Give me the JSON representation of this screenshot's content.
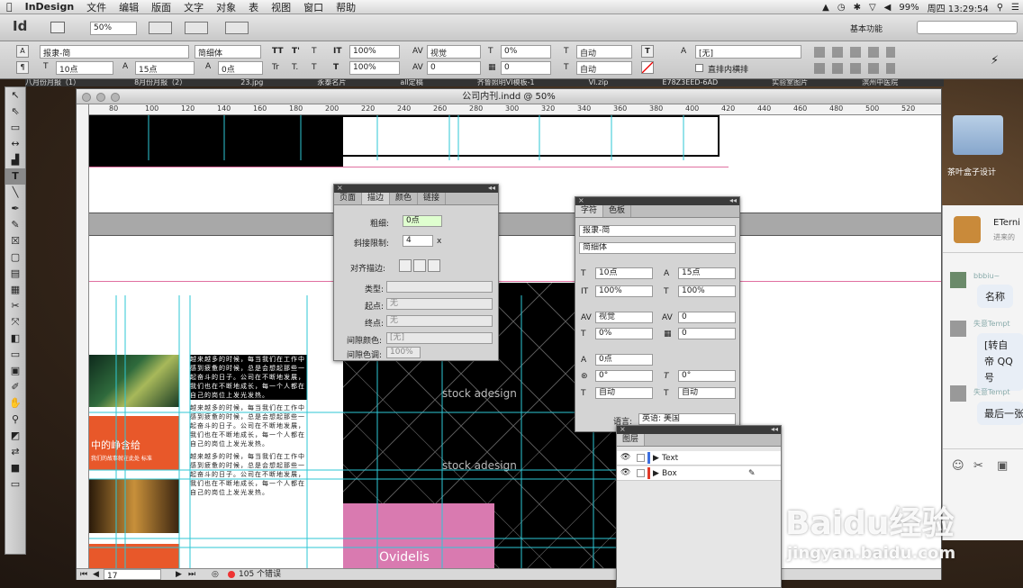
{
  "menubar": {
    "app": "InDesign",
    "items": [
      "文件",
      "编辑",
      "版面",
      "文字",
      "对象",
      "表",
      "视图",
      "窗口",
      "帮助"
    ],
    "battery": "99%",
    "clock": "周四 13:29:54"
  },
  "appbar": {
    "logo": "Id",
    "zoom": "50%",
    "workspace": "基本功能"
  },
  "control": {
    "font_family": "报隶-简",
    "font_style": "简细体",
    "font_size": "10点",
    "leading": "15点",
    "scale_v": "100%",
    "scale_h": "100%",
    "tracking": "视觉",
    "kerning": "0",
    "baseline": "0点",
    "skew": "0%",
    "tt": "TT",
    "tt2": "T'",
    "t3": "T",
    "tr": "Tr",
    "tr2": "T.",
    "tr3": "T",
    "auto1": "自动",
    "auto2": "自动",
    "none": "[无]",
    "shading_label": "直排内横排",
    "a_label": "A"
  },
  "tabs": [
    "八月份月报（1）",
    "8月份月报（2）",
    "23.jpg",
    "永泰名片",
    "all定稿",
    "齐鲁照明VI模板-1",
    "VI.zip",
    "E78Z3EED-6AD",
    "实验室图片",
    "滨州中医院"
  ],
  "document": {
    "title": "公司内刊.indd @ 50%",
    "ruler": [
      "80",
      "100",
      "120",
      "140",
      "160",
      "180",
      "200",
      "220",
      "240",
      "260",
      "280",
      "300",
      "320",
      "340",
      "360",
      "380",
      "400",
      "420",
      "440",
      "460",
      "480",
      "500",
      "520"
    ],
    "page_num": "17",
    "errors": "105 个错误",
    "orange_text_1": "中的峥含给",
    "orange_text_2": "我们的故事就在此处 标准",
    "pink_text": "Ovidelis",
    "watermark": "stock adesign",
    "body_text": "越来越多的时候，每当我们在工作中感到疲惫的时候，总是会想起那些一起奋斗的日子。公司在不断地发展，我们也在不断地成长，每一个人都在自己的岗位上发光发热。"
  },
  "stroke_panel": {
    "tabs": [
      "页面",
      "描边",
      "颜色",
      "链接"
    ],
    "weight_label": "粗细:",
    "weight": "0点",
    "miter_label": "斜接限制:",
    "miter": "4",
    "miter_x": "x",
    "align_label": "对齐描边:",
    "type_label": "类型:",
    "start_label": "起点:",
    "start": "无",
    "end_label": "终点:",
    "end": "无",
    "gap_color_label": "间隙颜色:",
    "gap_color": "[无]",
    "gap_tint_label": "间隙色调:",
    "gap_tint": "100%"
  },
  "char_panel": {
    "tabs": [
      "字符",
      "色板"
    ],
    "font": "报隶-简",
    "style": "简细体",
    "size": "10点",
    "leading": "15点",
    "scale_v": "100%",
    "scale_h": "100%",
    "kerning": "视觉",
    "tracking": "0",
    "skew_a": "0%",
    "skew_b": "0",
    "baseline": "0点",
    "rotate": "0°",
    "italic": "0°",
    "auto1": "自动",
    "auto2": "自动",
    "lang_label": "语言:",
    "lang": "英语: 美国"
  },
  "layers_panel": {
    "tab": "图层",
    "layers": [
      {
        "name": "Text",
        "color": "#3d6fe0"
      },
      {
        "name": "Box",
        "color": "#e03a2a"
      }
    ]
  },
  "desktop": {
    "folder": "茶叶盒子设计",
    "chat_user": "ETerni",
    "chat_sub": "进来的",
    "chat": [
      {
        "name": "bbbiu~",
        "msg": "名称"
      },
      {
        "name": "失意Tempt",
        "msg": "[转自帝 QQ号"
      },
      {
        "name": "失意Tempt",
        "msg": "最后一张"
      }
    ]
  },
  "watermark": {
    "brand": "Baidu经验",
    "url": "jingyan.baidu.com"
  }
}
